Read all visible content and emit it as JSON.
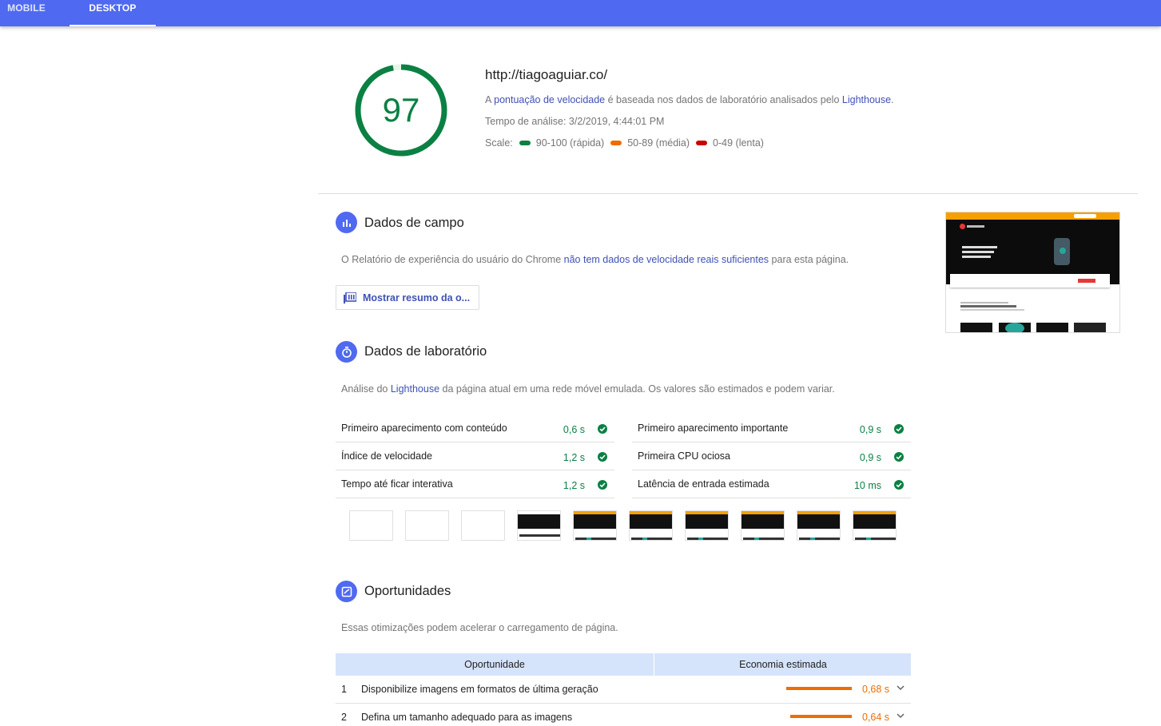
{
  "tabs": [
    {
      "label": "MOBILE",
      "active": false
    },
    {
      "label": "DESKTOP",
      "active": true
    }
  ],
  "score": {
    "value": "97",
    "fraction": 0.97,
    "color": "#0b8043"
  },
  "header": {
    "url": "http://tiagoaguiar.co/",
    "summary_prefix": "A ",
    "summary_link": "pontuação de velocidade",
    "summary_middle": " é baseada nos dados de laboratório analisados pelo ",
    "summary_link2": "Lighthouse",
    "summary_suffix": ".",
    "analysis_time": "Tempo de análise: 3/2/2019, 4:44:01 PM",
    "scale_label": "Scale:",
    "scale": [
      {
        "label": "90-100 (rápida)",
        "color": "#0b8043"
      },
      {
        "label": "50-89 (média)",
        "color": "#ef6c00"
      },
      {
        "label": "0-49 (lenta)",
        "color": "#cc0000"
      }
    ]
  },
  "field": {
    "title": "Dados de campo",
    "icon": "bar-chart-icon",
    "desc_prefix": "O Relatório de experiência do usuário do Chrome ",
    "desc_link": "não tem dados de velocidade reais suficientes",
    "desc_suffix": " para esta página.",
    "button_label": "Mostrar resumo da o..."
  },
  "lab": {
    "title": "Dados de laboratório",
    "icon": "stopwatch-icon",
    "desc_prefix": "Análise do ",
    "desc_link": "Lighthouse",
    "desc_suffix": " da página atual em uma rede móvel emulada. Os valores são estimados e podem variar.",
    "metrics_left": [
      {
        "name": "Primeiro aparecimento com conteúdo",
        "value": "0,6 s"
      },
      {
        "name": "Índice de velocidade",
        "value": "1,2 s"
      },
      {
        "name": "Tempo até ficar interativa",
        "value": "1,2 s"
      }
    ],
    "metrics_right": [
      {
        "name": "Primeiro aparecimento importante",
        "value": "0,9 s"
      },
      {
        "name": "Primeira CPU ociosa",
        "value": "0,9 s"
      },
      {
        "name": "Latência de entrada estimada",
        "value": "10 ms"
      }
    ]
  },
  "opportunities": {
    "title": "Oportunidades",
    "icon": "opportunity-icon",
    "desc": "Essas otimizações podem acelerar o carregamento de página.",
    "col_opportunity": "Oportunidade",
    "col_savings": "Economia estimada",
    "rows": [
      {
        "num": "1",
        "text": "Disponibilize imagens em formatos de última geração",
        "value": "0,68 s",
        "savings_seconds": 0.68
      },
      {
        "num": "2",
        "text": "Defina um tamanho adequado para as imagens",
        "value": "0,64 s",
        "savings_seconds": 0.64
      }
    ]
  }
}
